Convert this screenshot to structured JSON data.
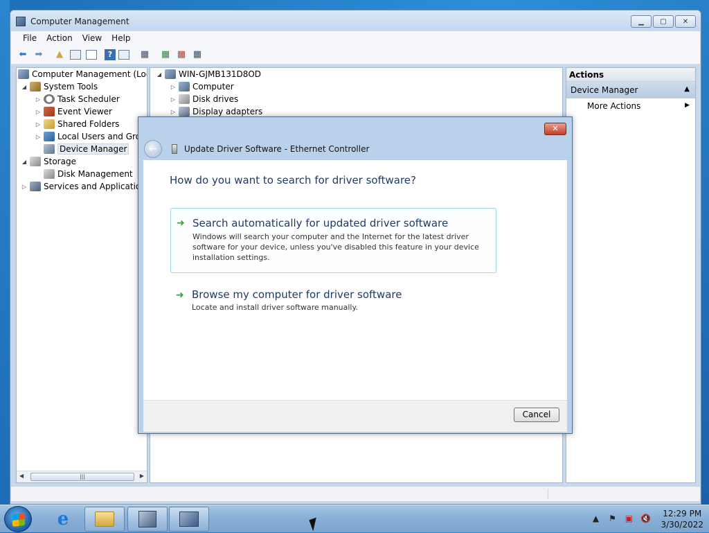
{
  "window": {
    "title": "Computer Management",
    "buttons": {
      "minimize": "▭",
      "maximize": "▣",
      "close": "✕"
    }
  },
  "menu": [
    "File",
    "Action",
    "View",
    "Help"
  ],
  "tree": {
    "root": "Computer Management (Local",
    "system_tools": "System Tools",
    "task_scheduler": "Task Scheduler",
    "event_viewer": "Event Viewer",
    "shared_folders": "Shared Folders",
    "local_users": "Local Users and Group",
    "device_manager": "Device Manager",
    "storage": "Storage",
    "disk_management": "Disk Management",
    "services": "Services and Applications"
  },
  "devices": {
    "host": "WIN-GJMB131D8OD",
    "items": [
      "Computer",
      "Disk drives",
      "Display adapters"
    ]
  },
  "actions": {
    "header": "Actions",
    "section": "Device Manager",
    "more": "More Actions"
  },
  "dialog": {
    "title": "Update Driver Software - Ethernet Controller",
    "question": "How do you want to search for driver software?",
    "option1_title": "Search automatically for updated driver software",
    "option1_desc": "Windows will search your computer and the Internet for the latest driver software for your device, unless you've disabled this feature in your device installation settings.",
    "option2_title": "Browse my computer for driver software",
    "option2_desc": "Locate and install driver software manually.",
    "cancel": "Cancel"
  },
  "taskbar": {
    "time": "12:29 PM",
    "date": "3/30/2022"
  },
  "colors": {
    "accent": "#1e3a6a",
    "arrow_green": "#3aa23a",
    "dialog_frame": "#b9d1ea"
  }
}
